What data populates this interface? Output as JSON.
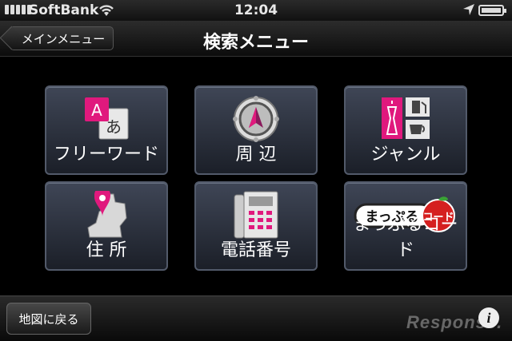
{
  "status_bar": {
    "carrier": "SoftBank",
    "time": "12:04"
  },
  "nav": {
    "back_label": "メインメニュー",
    "title": "検索メニュー"
  },
  "menu": {
    "items": [
      {
        "label": "フリーワード",
        "icon": "free-word-icon"
      },
      {
        "label": "周 辺",
        "icon": "nearby-compass-icon"
      },
      {
        "label": "ジャンル",
        "icon": "genre-icon"
      },
      {
        "label": "住 所",
        "icon": "address-map-pin-icon"
      },
      {
        "label": "電話番号",
        "icon": "telephone-icon"
      },
      {
        "label": "まっぷるコード",
        "icon": "mapple-code-icon"
      }
    ]
  },
  "icon_text": {
    "free_word_a": "A",
    "free_word_a2": "あ",
    "mapple_logo": "まっぷる",
    "mapple_code": "コード"
  },
  "toolbar": {
    "map_button": "地図に戻る"
  },
  "watermark": "Response.",
  "colors": {
    "accent_pink": "#e0197d",
    "tile_border": "#525a6a",
    "mapple_red": "#d51f1f"
  }
}
